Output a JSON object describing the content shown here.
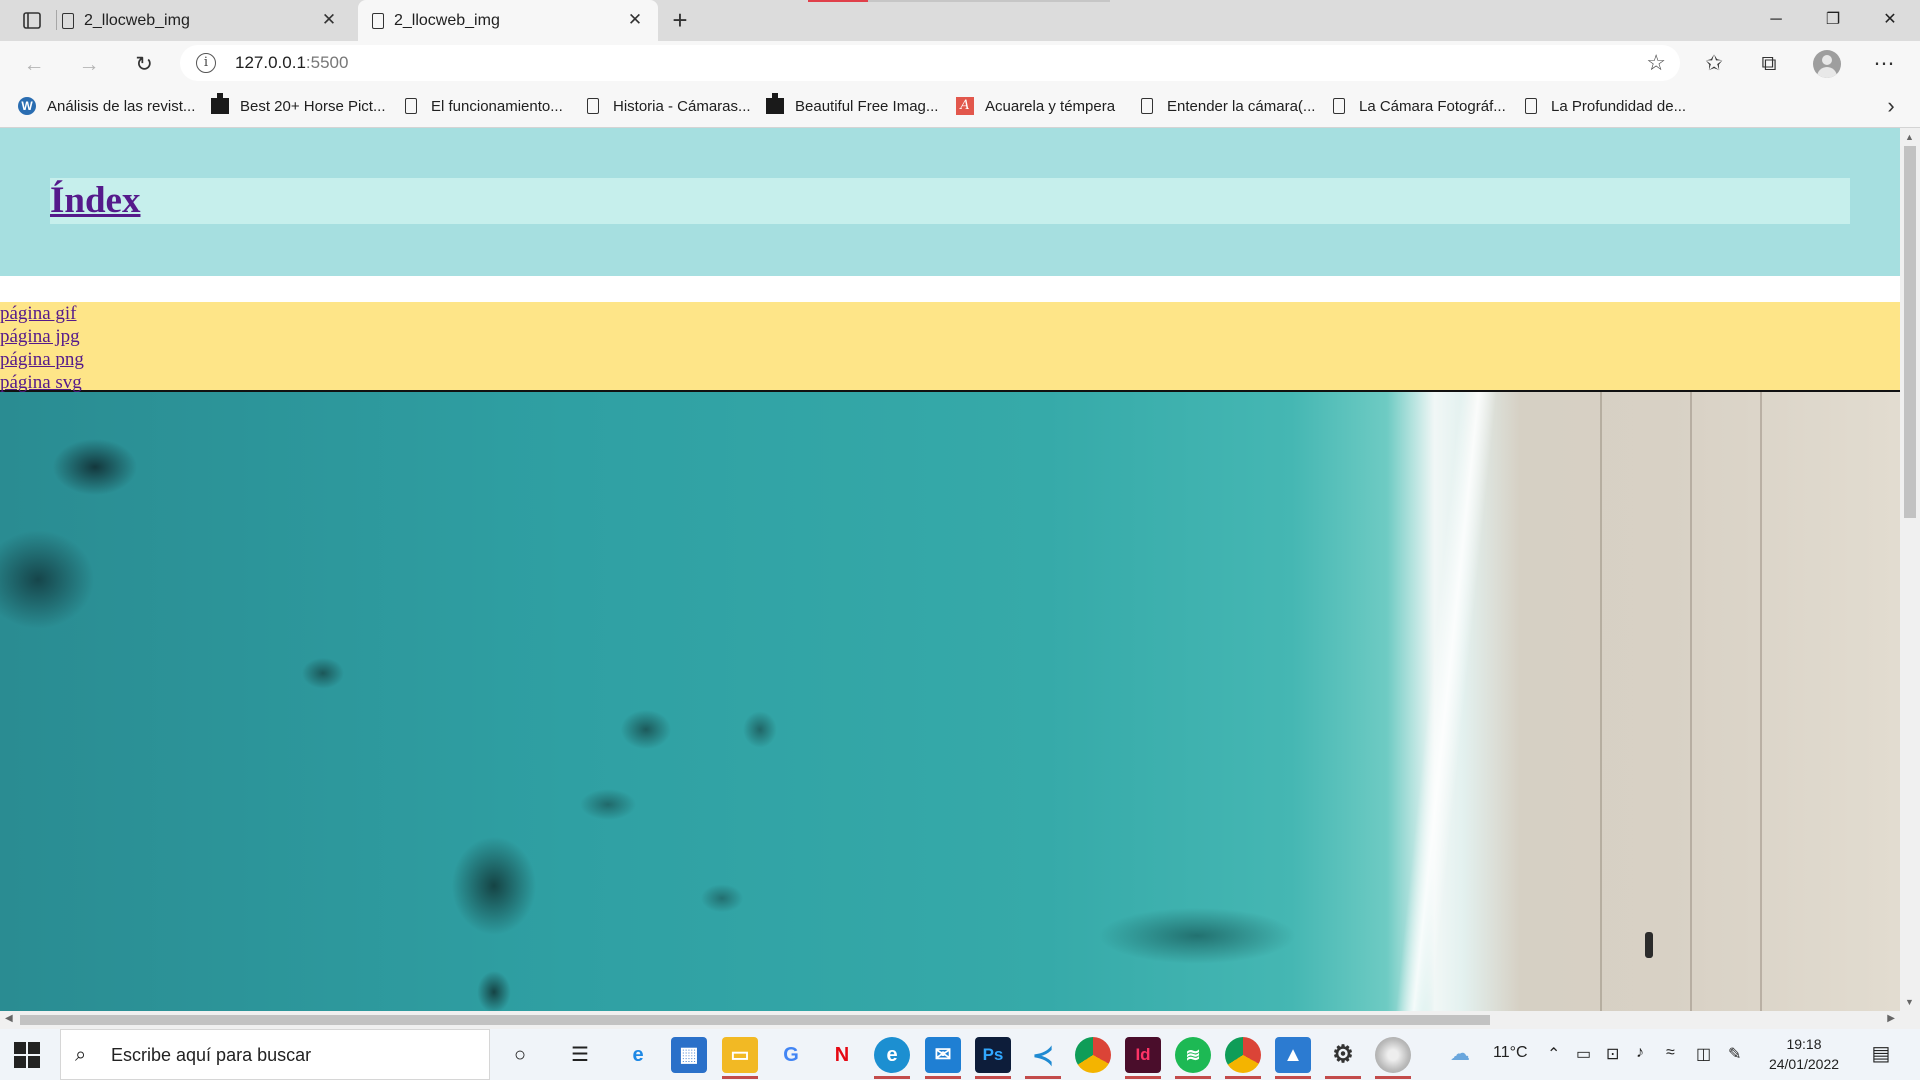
{
  "browser": {
    "tabs": [
      {
        "label": "2_llocweb_img",
        "active": false
      },
      {
        "label": "2_llocweb_img",
        "active": true
      }
    ],
    "address": {
      "host": "127.0.0.1",
      "port": ":5500"
    },
    "bookmarks": [
      {
        "label": "Análisis de las revist...",
        "icon": "wordpress-icon"
      },
      {
        "label": "Best 20+ Horse Pict...",
        "icon": "unsplash-icon"
      },
      {
        "label": "El funcionamiento...",
        "icon": "page-icon"
      },
      {
        "label": "Historia - Cámaras...",
        "icon": "page-icon"
      },
      {
        "label": "Beautiful Free Imag...",
        "icon": "unsplash-icon"
      },
      {
        "label": "Acuarela y témpera",
        "icon": "acuarela-icon"
      },
      {
        "label": "Entender la cámara(...",
        "icon": "page-icon"
      },
      {
        "label": "La Cámara Fotográf...",
        "icon": "page-icon"
      },
      {
        "label": "La Profundidad de...",
        "icon": "page-icon"
      }
    ]
  },
  "page": {
    "title": "Índex",
    "nav": [
      "página gif",
      "página jpg",
      "página png",
      "página svg"
    ],
    "hero_image": "aerial beach photo"
  },
  "taskbar": {
    "search_placeholder": "Escribe aquí para buscar",
    "weather": "11°C",
    "time": "19:18",
    "date": "24/01/2022",
    "apps": [
      "task-view-icon",
      "widgets-icon",
      "internet-explorer-icon",
      "store-icon",
      "file-explorer-icon",
      "google-icon",
      "netflix-icon",
      "edge-icon",
      "mail-icon",
      "photoshop-icon",
      "vscode-icon",
      "chrome-icon",
      "indesign-icon",
      "spotify-icon",
      "chrome-profile-icon",
      "photos-icon",
      "settings-icon",
      "dvd-icon"
    ]
  },
  "colors": {
    "header_bg": "#a6dfe0",
    "title_bar_bg": "#c6efec",
    "nav_bg": "#fee588",
    "link_color": "#551a8b"
  }
}
